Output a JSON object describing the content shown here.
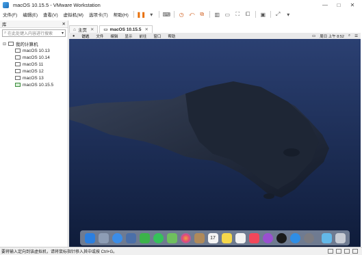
{
  "window": {
    "title": "macOS 10.15.5 - VMware Workstation"
  },
  "menubar": {
    "items": [
      "文件(F)",
      "编辑(E)",
      "查看(V)",
      "虚拟机(M)",
      "选项卡(T)",
      "帮助(H)"
    ]
  },
  "library": {
    "title": "库",
    "search_placeholder": "在此处键入内容进行搜索",
    "root_label": "我的计算机",
    "vms": [
      "macOS 10.13",
      "macOS 10.14",
      "macOS 11",
      "macOS 12",
      "macOS 13",
      "macOS 10.15.5"
    ]
  },
  "tabs": [
    {
      "label": "主页"
    },
    {
      "label": "macOS 10.15.5"
    }
  ],
  "guest_menubar": {
    "items": [
      "访达",
      "文件",
      "编辑",
      "显示",
      "前往",
      "窗口",
      "帮助"
    ],
    "clock": "周日 上午 8:52"
  },
  "dock": {
    "icons": [
      {
        "name": "finder-icon",
        "color": "#2b7fe0"
      },
      {
        "name": "launchpad-icon",
        "color": "#8d9db5"
      },
      {
        "name": "safari-icon",
        "color": "#3b8de8"
      },
      {
        "name": "preview-icon",
        "color": "#4b6fa8"
      },
      {
        "name": "facetime-icon",
        "color": "#3cb34a"
      },
      {
        "name": "messages-icon",
        "color": "#35c25a"
      },
      {
        "name": "maps-icon",
        "color": "#6fbf5e"
      },
      {
        "name": "photos-icon",
        "color": "#f2a23c"
      },
      {
        "name": "contacts-icon",
        "color": "#b08a5a"
      },
      {
        "name": "calendar-icon",
        "color": "#f4f4f4"
      },
      {
        "name": "notes-icon",
        "color": "#f5d74a"
      },
      {
        "name": "reminders-icon",
        "color": "#f2f2f2"
      },
      {
        "name": "music-icon",
        "color": "#f2475a"
      },
      {
        "name": "podcasts-icon",
        "color": "#9a4fd0"
      },
      {
        "name": "tv-icon",
        "color": "#1a1a1a"
      },
      {
        "name": "app-store-icon",
        "color": "#2f8ee6"
      },
      {
        "name": "system-preferences-icon",
        "color": "#7c7c82"
      },
      {
        "name": "downloads-icon",
        "color": "#63b8e8"
      },
      {
        "name": "trash-icon",
        "color": "#c8ccd4"
      }
    ],
    "calendar_day": "17"
  },
  "statusbar": {
    "text": "要将输入定向到该虚拟机，请将鼠标指针移入其中或按 Ctrl+G。"
  }
}
